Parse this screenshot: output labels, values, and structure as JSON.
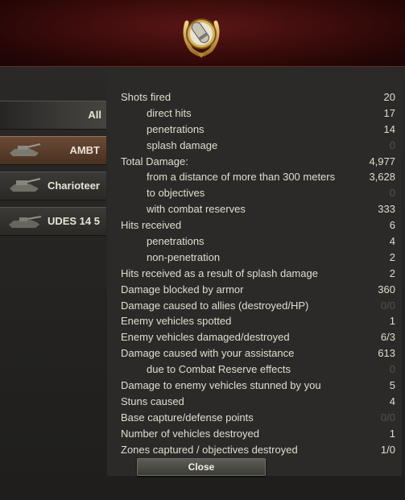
{
  "tabs": [
    {
      "label": "All",
      "active": false
    },
    {
      "label": "AMBT",
      "active": true
    },
    {
      "label": "Charioteer",
      "active": false
    },
    {
      "label": "UDES 14 5",
      "active": false
    }
  ],
  "stats": [
    {
      "label": "Shots fired",
      "value": "20",
      "sub": false,
      "dim": false
    },
    {
      "label": "direct hits",
      "value": "17",
      "sub": true,
      "dim": false
    },
    {
      "label": "penetrations",
      "value": "14",
      "sub": true,
      "dim": false
    },
    {
      "label": "splash damage",
      "value": "0",
      "sub": true,
      "dim": true
    },
    {
      "label": "Total Damage:",
      "value": "4,977",
      "sub": false,
      "dim": false
    },
    {
      "label": "from a distance of more than 300 meters",
      "value": "3,628",
      "sub": true,
      "dim": false
    },
    {
      "label": "to objectives",
      "value": "0",
      "sub": true,
      "dim": true
    },
    {
      "label": "with combat reserves",
      "value": "333",
      "sub": true,
      "dim": false
    },
    {
      "label": "Hits received",
      "value": "6",
      "sub": false,
      "dim": false
    },
    {
      "label": "penetrations",
      "value": "4",
      "sub": true,
      "dim": false
    },
    {
      "label": "non-penetration",
      "value": "2",
      "sub": true,
      "dim": false
    },
    {
      "label": "Hits received as a result of splash damage",
      "value": "2",
      "sub": false,
      "dim": false
    },
    {
      "label": "Damage blocked by armor",
      "value": "360",
      "sub": false,
      "dim": false
    },
    {
      "label": "Damage caused to allies (destroyed/HP)",
      "value": "0/0",
      "sub": false,
      "dim": true
    },
    {
      "label": "Enemy vehicles spotted",
      "value": "1",
      "sub": false,
      "dim": false
    },
    {
      "label": "Enemy vehicles damaged/destroyed",
      "value": "6/3",
      "sub": false,
      "dim": false
    },
    {
      "label": "Damage caused with your assistance",
      "value": "613",
      "sub": false,
      "dim": false
    },
    {
      "label": "due to Combat Reserve effects",
      "value": "0",
      "sub": true,
      "dim": true
    },
    {
      "label": "Damage to enemy vehicles stunned by you",
      "value": "5",
      "sub": false,
      "dim": false
    },
    {
      "label": "Stuns caused",
      "value": "4",
      "sub": false,
      "dim": false
    },
    {
      "label": "Base capture/defense points",
      "value": "0/0",
      "sub": false,
      "dim": true
    },
    {
      "label": "Number of vehicles destroyed",
      "value": "1",
      "sub": false,
      "dim": false
    },
    {
      "label": "Zones captured / objectives destroyed",
      "value": "1/0",
      "sub": false,
      "dim": false
    }
  ],
  "close_label": "Close",
  "icons": {
    "medal": "medal-laurel-icon",
    "tank": "tank-icon"
  },
  "colors": {
    "header": "#3d0c0c",
    "active_tab": "#5a3c2a",
    "panel": "#2b2a28",
    "text": "#e0dccf",
    "dim": "#55534d"
  }
}
